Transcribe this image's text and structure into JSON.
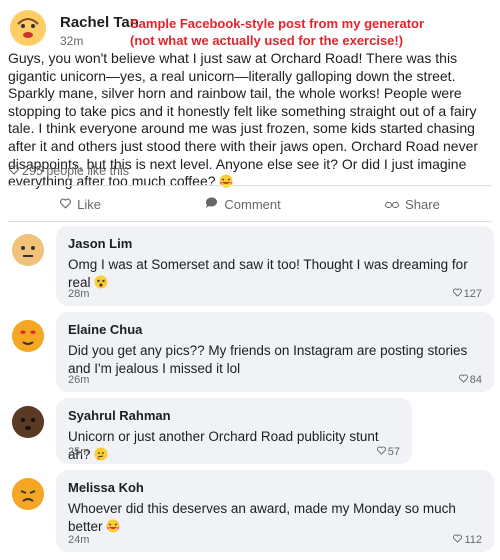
{
  "post": {
    "author": "Rachel Tan",
    "time": "32m",
    "annotation": "Sample Facebook-style post from my generator (not what we actually used for the exercise!)",
    "text": "Guys, you won't believe what I just saw at Orchard Road! There was this gigantic unicorn—yes, a real unicorn—literally galloping down the street. Sparkly mane, silver horn and rainbow tail, the whole works! People were stopping to take pics and it honestly felt like something straight out of a fairy tale. I think everyone around me was just frozen, some kids started chasing after it and others just stood there with their jaws open. Orchard Road never disappoints, but this is next level. Anyone else see it? Or did I just imagine everything after too much coffee?",
    "likes": "295 people like this",
    "actions": {
      "like": "Like",
      "comment": "Comment",
      "share": "Share"
    }
  },
  "comments": [
    {
      "name": "Jason Lim",
      "text": "Omg I was at Somerset and saw it too! Thought I was dreaming for real",
      "time": "28m",
      "likes": "127",
      "avatar_color": "#f2c27a",
      "emoji_icon": "dizzy-face-icon"
    },
    {
      "name": "Elaine Chua",
      "text": "Did you get any pics?? My friends on Instagram are posting stories and I'm jealous I missed it lol",
      "time": "26m",
      "likes": "84",
      "avatar_color": "#f5a623",
      "emoji_icon": "heart-eyes-icon"
    },
    {
      "name": "Syahrul Rahman",
      "text": "Unicorn or just another Orchard Road publicity stunt ah?",
      "time": "25m",
      "likes": "57",
      "avatar_color": "#5b3a24",
      "emoji_icon": "thinking-face-icon"
    },
    {
      "name": "Melissa Koh",
      "text": "Whoever did this deserves an award, made my Monday so much better",
      "time": "24m",
      "likes": "112",
      "avatar_color": "#f5a623",
      "emoji_icon": "laughing-face-icon"
    }
  ]
}
